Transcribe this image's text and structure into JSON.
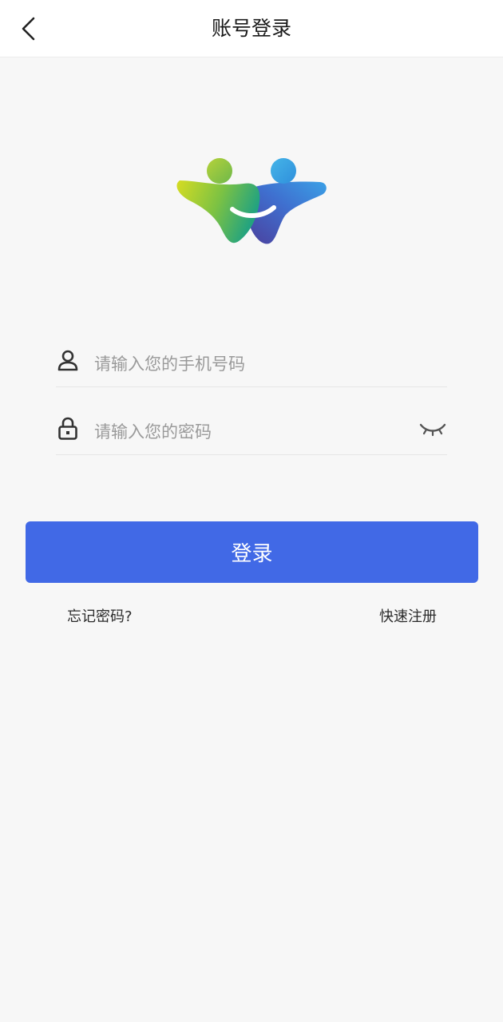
{
  "header": {
    "title": "账号登录",
    "back_icon": "chevron-left-icon"
  },
  "logo": {
    "colors": {
      "green_left": "#c8d92a",
      "green": "#6cbf4a",
      "teal": "#2aa7a0",
      "blue": "#3b8fe0",
      "purple": "#4a4fa8"
    }
  },
  "form": {
    "phone": {
      "icon": "user-icon",
      "placeholder": "请输入您的手机号码",
      "value": ""
    },
    "password": {
      "icon": "lock-icon",
      "placeholder": "请输入您的密码",
      "value": "",
      "toggle_icon": "eye-closed-icon"
    }
  },
  "actions": {
    "login_label": "登录",
    "forgot_label": "忘记密码?",
    "register_label": "快速注册"
  },
  "colors": {
    "primary": "#4169e6",
    "background": "#f7f7f7",
    "header_bg": "#ffffff"
  }
}
